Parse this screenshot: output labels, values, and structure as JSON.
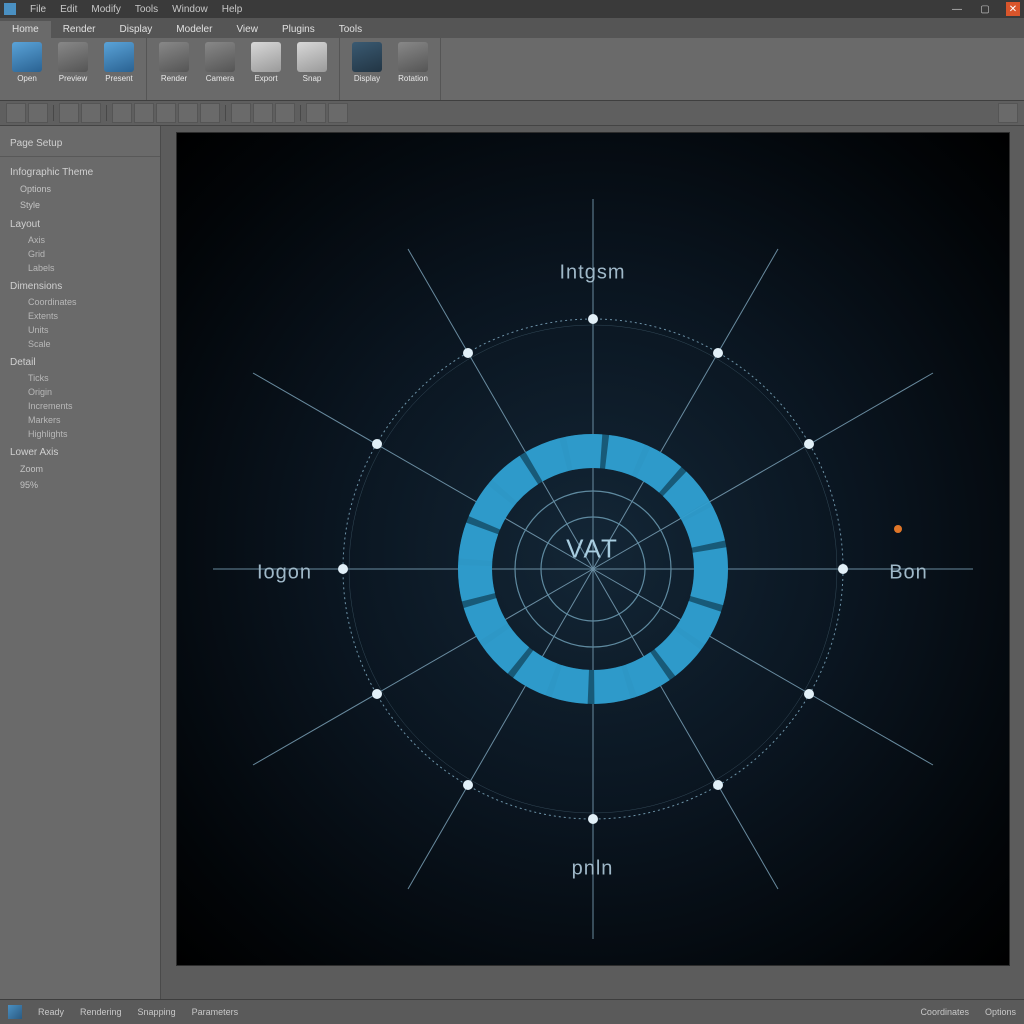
{
  "menubar": {
    "items": [
      "File",
      "Edit",
      "Modify",
      "Tools",
      "Window",
      "Help"
    ]
  },
  "ribbon_tabs": [
    "Home",
    "Render",
    "Display",
    "Modeler",
    "View",
    "Plugins",
    "Tools"
  ],
  "ribbon": {
    "groups": [
      {
        "items": [
          {
            "label": "Open",
            "icon": "folder-icon",
            "cls": "ico-blue"
          },
          {
            "label": "Preview",
            "icon": "preview-icon",
            "cls": "ico-grey"
          },
          {
            "label": "Present",
            "icon": "present-icon",
            "cls": "ico-blue"
          }
        ]
      },
      {
        "items": [
          {
            "label": "Render",
            "icon": "render-icon",
            "cls": "ico-grey"
          },
          {
            "label": "Camera",
            "icon": "camera-icon",
            "cls": "ico-grey"
          },
          {
            "label": "Export",
            "icon": "export-icon",
            "cls": "ico-white"
          },
          {
            "label": "Snap",
            "icon": "snap-icon",
            "cls": "ico-white"
          }
        ]
      },
      {
        "items": [
          {
            "label": "Display",
            "icon": "display-icon",
            "cls": "ico-dark"
          },
          {
            "label": "Rotation",
            "icon": "rotation-icon",
            "cls": "ico-grey"
          }
        ]
      }
    ]
  },
  "sidebar": {
    "title": "Page Setup",
    "sections": [
      {
        "header": "Infographic Theme",
        "items": [
          "Options",
          "Style"
        ]
      },
      {
        "header": "Layout",
        "items": [
          "Axis",
          "Grid",
          "Labels"
        ]
      },
      {
        "header": "Dimensions",
        "items": [
          "Coordinates",
          "Extents",
          "Units",
          "Scale"
        ]
      },
      {
        "header": "Detail",
        "items": [
          "Ticks",
          "Origin",
          "Increments",
          "Markers",
          "Highlights"
        ]
      },
      {
        "header": "Lower Axis",
        "items": [
          "Zoom",
          "95%"
        ]
      }
    ]
  },
  "diagram": {
    "center": "VAT",
    "axis_labels": {
      "top": "Intgsm",
      "right": "Bon",
      "bottom": "pnln",
      "left": "Iogon"
    }
  },
  "statusbar": {
    "items": [
      "Ready",
      "Rendering",
      "Snapping",
      "Parameters"
    ],
    "right": [
      "Coordinates",
      "Options"
    ]
  },
  "colors": {
    "accent": "#2f9ecf",
    "accent_light": "#62c2e6",
    "ring_dark": "#185a78",
    "canvas_line": "#7aa0b6"
  }
}
